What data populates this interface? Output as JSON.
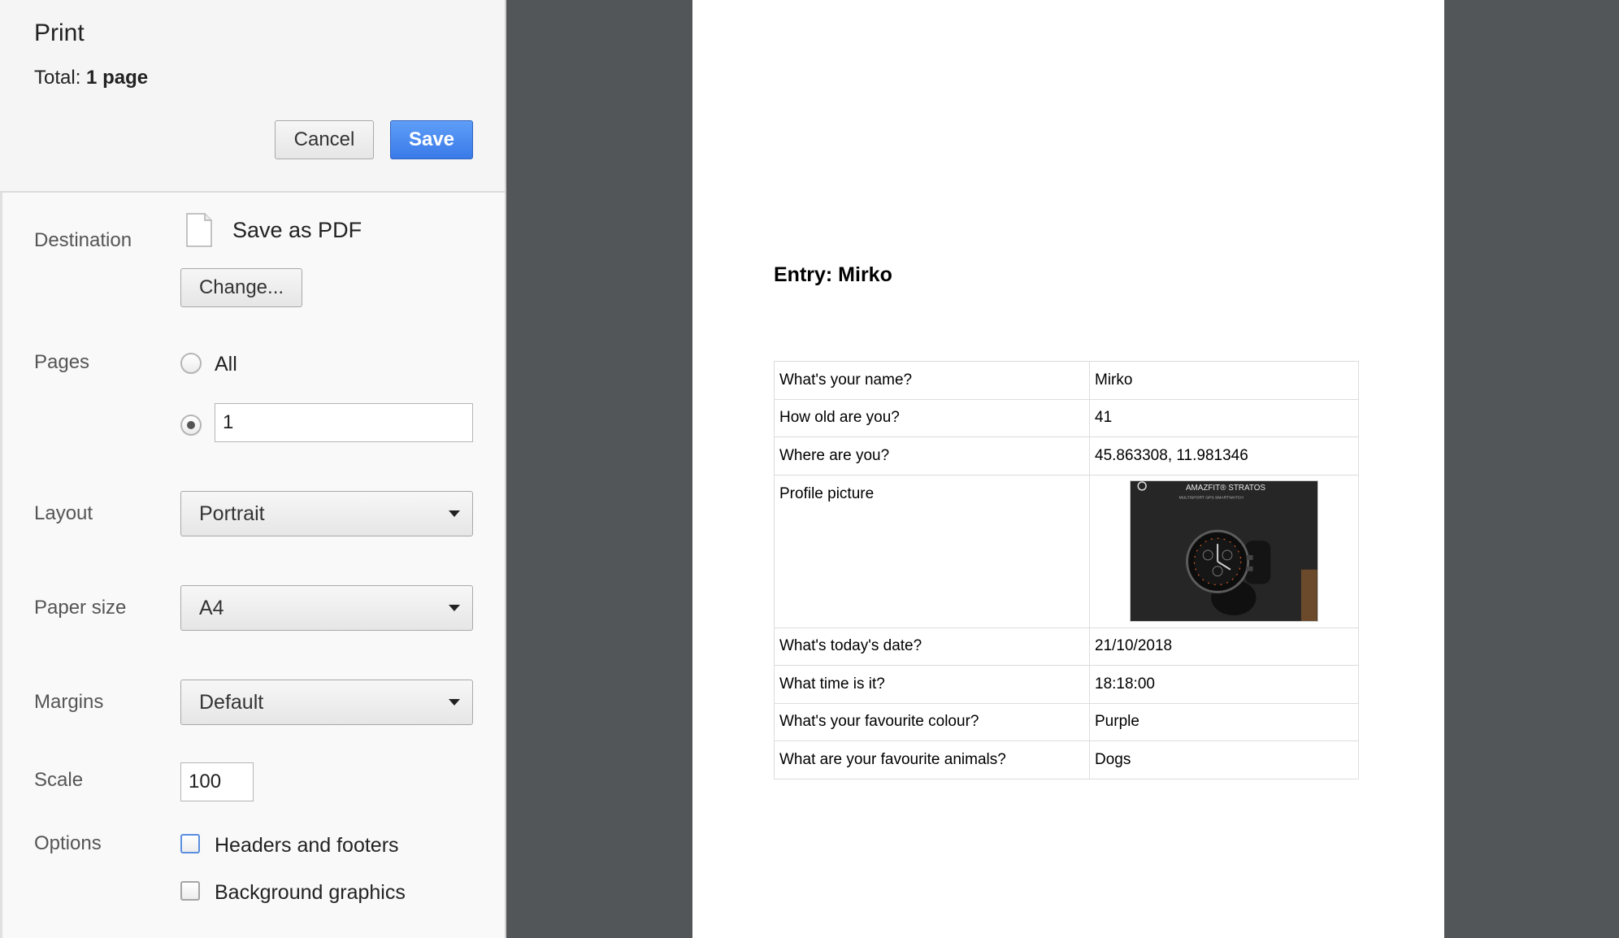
{
  "header": {
    "title": "Print",
    "total_label": "Total:",
    "total_value": "1 page",
    "cancel_label": "Cancel",
    "save_label": "Save"
  },
  "destination": {
    "label": "Destination",
    "name": "Save as PDF",
    "change_label": "Change..."
  },
  "pages": {
    "label": "Pages",
    "all_label": "All",
    "custom_value": "1"
  },
  "layout": {
    "label": "Layout",
    "value": "Portrait"
  },
  "paper_size": {
    "label": "Paper size",
    "value": "A4"
  },
  "margins": {
    "label": "Margins",
    "value": "Default"
  },
  "scale": {
    "label": "Scale",
    "value": "100"
  },
  "options": {
    "label": "Options",
    "headers_footers": "Headers and footers",
    "background_graphics": "Background graphics"
  },
  "colors": {
    "primary_button": "#3a7ae8",
    "preview_background": "#525659"
  },
  "preview": {
    "entry_title": "Entry: Mirko",
    "rows": [
      {
        "question": "What's your name?",
        "answer": "Mirko"
      },
      {
        "question": "How old are you?",
        "answer": "41"
      },
      {
        "question": "Where are you?",
        "answer": "45.863308, 11.981346"
      },
      {
        "question": "Profile picture",
        "answer": ""
      },
      {
        "question": "What's today's date?",
        "answer": "21/10/2018"
      },
      {
        "question": "What time is it?",
        "answer": "18:18:00"
      },
      {
        "question": "What's your favourite colour?",
        "answer": "Purple"
      },
      {
        "question": "What are your favourite animals?",
        "answer": "Dogs"
      }
    ],
    "photo": {
      "brand_text": "AMAZFIT® STRATOS",
      "sub_text": "MULTISPORT GPS SMARTWATCH"
    }
  }
}
